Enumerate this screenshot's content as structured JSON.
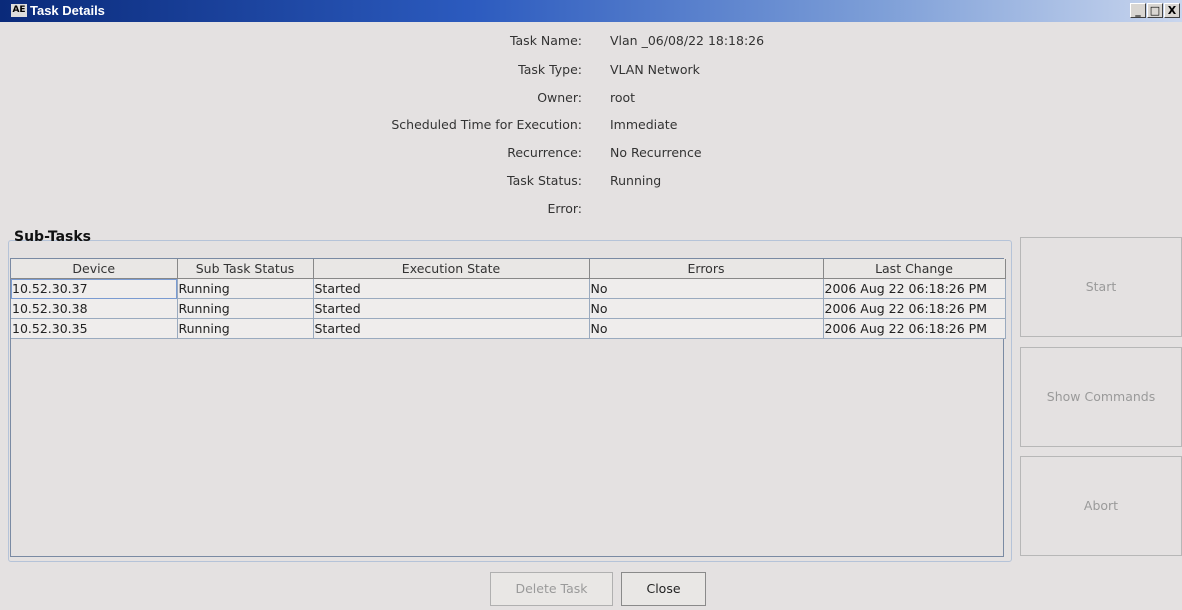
{
  "window": {
    "title": "Task Details",
    "app_icon": "AE",
    "minimize": "_",
    "maximize": "□",
    "close": "X"
  },
  "task": {
    "fields": [
      {
        "label": "Task Name:",
        "value": "Vlan _06/08/22 18:18:26"
      },
      {
        "label": "Task Type:",
        "value": "VLAN Network"
      },
      {
        "label": "Owner:",
        "value": "root"
      },
      {
        "label": "Scheduled Time for Execution:",
        "value": "Immediate"
      },
      {
        "label": "Recurrence:",
        "value": "No Recurrence"
      },
      {
        "label": "Task Status:",
        "value": "Running"
      },
      {
        "label": "Error:",
        "value": ""
      }
    ]
  },
  "subtasks": {
    "title": "Sub-Tasks",
    "columns": [
      "Device",
      "Sub Task Status",
      "Execution State",
      "Errors",
      "Last Change"
    ],
    "rows": [
      [
        "10.52.30.37",
        "Running",
        "Started",
        "No",
        "2006 Aug 22  06:18:26 PM"
      ],
      [
        "10.52.30.38",
        "Running",
        "Started",
        "No",
        "2006 Aug 22  06:18:26 PM"
      ],
      [
        "10.52.30.35",
        "Running",
        "Started",
        "No",
        "2006 Aug 22  06:18:26 PM"
      ]
    ]
  },
  "actions": {
    "start": "Start",
    "show_commands": "Show Commands",
    "abort": "Abort",
    "delete_task": "Delete Task",
    "close": "Close"
  }
}
